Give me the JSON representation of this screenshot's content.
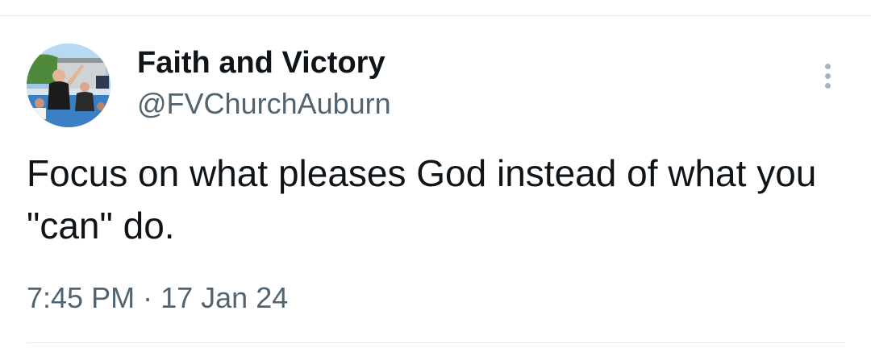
{
  "tweet": {
    "author": {
      "display_name": "Faith and Victory",
      "handle": "@FVChurchAuburn"
    },
    "more_icon": "more-vertical-icon",
    "text": "Focus on what pleases God instead of what you \"can\" do.",
    "time": "7:45 PM",
    "separator": "·",
    "date": "17 Jan 24"
  },
  "colors": {
    "primary_text": "#0f1419",
    "secondary_text": "#536471",
    "divider": "#e7e9ea",
    "more_dots": "#a6b4bd"
  }
}
